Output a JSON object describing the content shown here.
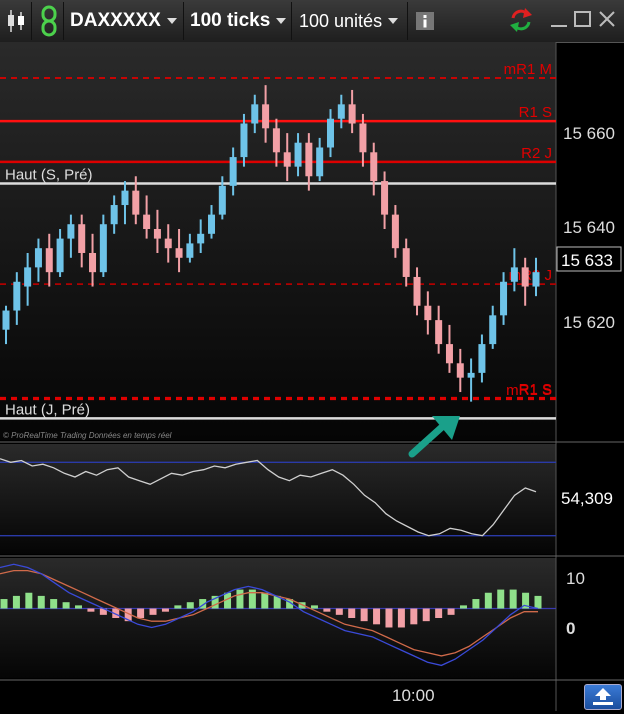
{
  "toolbar": {
    "instrument": "DAXXXXX",
    "period": "100 ticks",
    "units": "100 unités",
    "info_icon": "info-icon",
    "sync_icon": "sync-arrows-icon",
    "minimize_icon": "minimize-icon",
    "maximize_icon": "maximize-icon",
    "close_icon": "close-icon"
  },
  "price_axis": {
    "labels": [
      "15 660",
      "15 640",
      "15 620"
    ],
    "current_price": "15 633"
  },
  "levels": [
    {
      "label": "mR1 M",
      "price": 15673.5,
      "style": "dashed",
      "color": "#e00000"
    },
    {
      "label": "R1 S",
      "price": 15664.5,
      "style": "solid",
      "color": "#ff1010"
    },
    {
      "label": "R2 J",
      "price": 15656,
      "style": "solid",
      "color": "#dd0000"
    },
    {
      "label": "Haut (S, Pré)",
      "price": 15651.5,
      "style": "solid",
      "color": "#dcdcdc"
    },
    {
      "label": "mR2 J",
      "price": 15630.5,
      "style": "dashed",
      "color": "#b00000"
    },
    {
      "label": "mR1 S",
      "price": 15606.5,
      "style": "dashed",
      "color": "#e00000"
    },
    {
      "label": "R1 S",
      "price": 15606.8,
      "style": "dashed",
      "color": "#e00000"
    },
    {
      "label": "Haut (J, Pré)",
      "price": 15602.5,
      "style": "solid",
      "color": "#dcdcdc"
    }
  ],
  "watermark": "© ProRealTime Trading Données en temps réel",
  "chart_data": {
    "type": "candlestick",
    "y_range": [
      15598,
      15681
    ],
    "bars": [
      {
        "o": 15621,
        "h": 15626,
        "l": 15618,
        "c": 15625
      },
      {
        "o": 15625,
        "h": 15633,
        "l": 15622,
        "c": 15631
      },
      {
        "o": 15630,
        "h": 15637,
        "l": 15626,
        "c": 15634
      },
      {
        "o": 15634,
        "h": 15640,
        "l": 15631,
        "c": 15638
      },
      {
        "o": 15638,
        "h": 15641,
        "l": 15630,
        "c": 15633
      },
      {
        "o": 15633,
        "h": 15642,
        "l": 15632,
        "c": 15640
      },
      {
        "o": 15640,
        "h": 15645,
        "l": 15636,
        "c": 15643
      },
      {
        "o": 15643,
        "h": 15645,
        "l": 15634,
        "c": 15637
      },
      {
        "o": 15637,
        "h": 15641,
        "l": 15630,
        "c": 15633
      },
      {
        "o": 15633,
        "h": 15645,
        "l": 15632,
        "c": 15643
      },
      {
        "o": 15643,
        "h": 15649,
        "l": 15641,
        "c": 15647
      },
      {
        "o": 15647,
        "h": 15652,
        "l": 15643,
        "c": 15650
      },
      {
        "o": 15650,
        "h": 15653,
        "l": 15643,
        "c": 15645
      },
      {
        "o": 15645,
        "h": 15649,
        "l": 15640,
        "c": 15642
      },
      {
        "o": 15642,
        "h": 15646,
        "l": 15637,
        "c": 15640
      },
      {
        "o": 15640,
        "h": 15643,
        "l": 15635,
        "c": 15638
      },
      {
        "o": 15638,
        "h": 15642,
        "l": 15633,
        "c": 15636
      },
      {
        "o": 15636,
        "h": 15641,
        "l": 15635,
        "c": 15639
      },
      {
        "o": 15639,
        "h": 15644,
        "l": 15637,
        "c": 15641
      },
      {
        "o": 15641,
        "h": 15647,
        "l": 15640,
        "c": 15645
      },
      {
        "o": 15645,
        "h": 15653,
        "l": 15644,
        "c": 15651
      },
      {
        "o": 15651,
        "h": 15659,
        "l": 15649,
        "c": 15657
      },
      {
        "o": 15657,
        "h": 15666,
        "l": 15655,
        "c": 15664
      },
      {
        "o": 15664,
        "h": 15670,
        "l": 15662,
        "c": 15668
      },
      {
        "o": 15668,
        "h": 15672,
        "l": 15660,
        "c": 15663
      },
      {
        "o": 15663,
        "h": 15665,
        "l": 15655,
        "c": 15658
      },
      {
        "o": 15658,
        "h": 15662,
        "l": 15652,
        "c": 15655
      },
      {
        "o": 15655,
        "h": 15662,
        "l": 15653,
        "c": 15660
      },
      {
        "o": 15660,
        "h": 15662,
        "l": 15650,
        "c": 15653
      },
      {
        "o": 15653,
        "h": 15661,
        "l": 15652,
        "c": 15659
      },
      {
        "o": 15659,
        "h": 15667,
        "l": 15657,
        "c": 15665
      },
      {
        "o": 15665,
        "h": 15670,
        "l": 15663,
        "c": 15668
      },
      {
        "o": 15668,
        "h": 15671,
        "l": 15662,
        "c": 15664
      },
      {
        "o": 15664,
        "h": 15666,
        "l": 15655,
        "c": 15658
      },
      {
        "o": 15658,
        "h": 15660,
        "l": 15649,
        "c": 15652
      },
      {
        "o": 15652,
        "h": 15654,
        "l": 15642,
        "c": 15645
      },
      {
        "o": 15645,
        "h": 15647,
        "l": 15636,
        "c": 15638
      },
      {
        "o": 15638,
        "h": 15640,
        "l": 15630,
        "c": 15632
      },
      {
        "o": 15632,
        "h": 15634,
        "l": 15624,
        "c": 15626
      },
      {
        "o": 15626,
        "h": 15629,
        "l": 15620,
        "c": 15623
      },
      {
        "o": 15623,
        "h": 15626,
        "l": 15616,
        "c": 15618
      },
      {
        "o": 15618,
        "h": 15622,
        "l": 15612,
        "c": 15614
      },
      {
        "o": 15614,
        "h": 15617,
        "l": 15608,
        "c": 15611
      },
      {
        "o": 15611,
        "h": 15615,
        "l": 15606,
        "c": 15612
      },
      {
        "o": 15612,
        "h": 15620,
        "l": 15610,
        "c": 15618
      },
      {
        "o": 15618,
        "h": 15626,
        "l": 15617,
        "c": 15624
      },
      {
        "o": 15624,
        "h": 15633,
        "l": 15622,
        "c": 15631
      },
      {
        "o": 15631,
        "h": 15638,
        "l": 15629,
        "c": 15634
      },
      {
        "o": 15634,
        "h": 15636,
        "l": 15626,
        "c": 15630
      },
      {
        "o": 15630,
        "h": 15636,
        "l": 15628,
        "c": 15633
      }
    ],
    "rsi": {
      "current_value": "54,309",
      "range": [
        20,
        80
      ],
      "bands": [
        70,
        30
      ],
      "values": [
        72,
        70,
        71,
        68,
        69,
        67,
        64,
        62,
        65,
        63,
        66,
        67,
        62,
        60,
        58,
        61,
        64,
        63,
        65,
        66,
        68,
        67,
        69,
        70,
        71,
        66,
        62,
        60,
        63,
        62,
        64,
        66,
        63,
        58,
        52,
        48,
        42,
        38,
        35,
        32,
        30,
        31,
        34,
        33,
        31,
        30,
        36,
        44,
        52,
        56,
        54
      ]
    },
    "macd": {
      "tick_labels": [
        "10",
        "0"
      ],
      "time_label": "10:00",
      "histogram": [
        3,
        4,
        5,
        4,
        3,
        2,
        1,
        -1,
        -2,
        -3,
        -4,
        -3,
        -2,
        -1,
        1,
        2,
        3,
        4,
        5,
        6,
        6,
        5,
        4,
        3,
        2,
        1,
        -1,
        -2,
        -3,
        -4,
        -5,
        -6,
        -6,
        -5,
        -4,
        -3,
        -2,
        1,
        3,
        5,
        6,
        6,
        5,
        4
      ],
      "macd_line": [
        13,
        14,
        13,
        11,
        8,
        5,
        3,
        1,
        -1,
        -3,
        -5,
        -6,
        -5,
        -3,
        -1,
        2,
        4,
        6,
        7,
        6,
        4,
        2,
        -1,
        -3,
        -5,
        -7,
        -8,
        -9,
        -11,
        -13,
        -15,
        -17,
        -18,
        -16,
        -13,
        -10,
        -6,
        -2,
        1,
        0
      ],
      "signal_line": [
        11,
        12,
        12,
        11,
        9,
        7,
        5,
        3,
        1,
        -1,
        -3,
        -4,
        -4,
        -3,
        -2,
        0,
        2,
        4,
        5,
        5,
        4,
        3,
        1,
        -1,
        -3,
        -5,
        -6,
        -7,
        -9,
        -11,
        -13,
        -14,
        -15,
        -14,
        -12,
        -9,
        -6,
        -3,
        -1,
        -1
      ]
    }
  }
}
